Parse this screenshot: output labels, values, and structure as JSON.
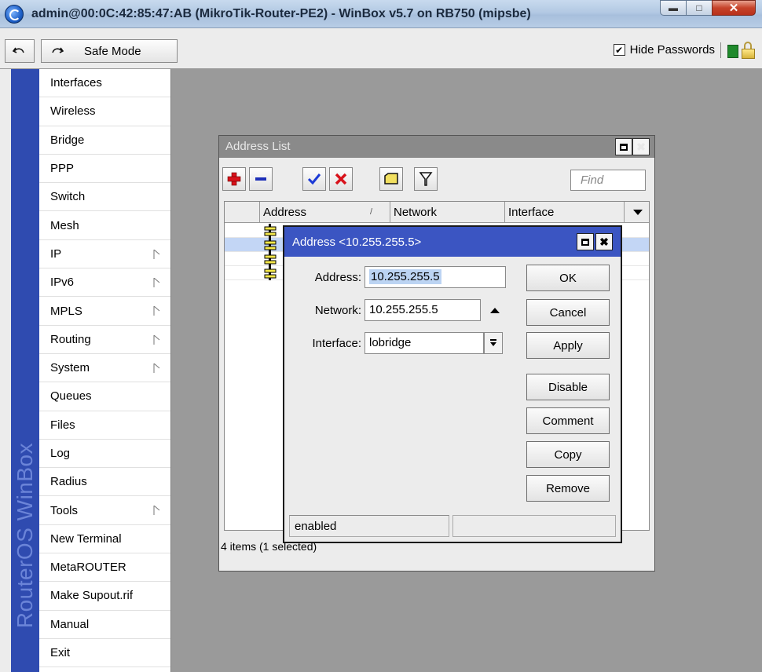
{
  "window": {
    "title": "admin@00:0C:42:85:47:AB (MikroTik-Router-PE2) - WinBox v5.7 on RB750 (mipsbe)"
  },
  "toolbar": {
    "undo_icon": "undo-icon",
    "redo_icon": "redo-icon",
    "safe_mode_label": "Safe Mode",
    "hide_passwords_label": "Hide Passwords",
    "hide_passwords_checked": true
  },
  "sidebar": {
    "brand": "RouterOS WinBox",
    "items": [
      {
        "label": "Interfaces",
        "submenu": false
      },
      {
        "label": "Wireless",
        "submenu": false
      },
      {
        "label": "Bridge",
        "submenu": false
      },
      {
        "label": "PPP",
        "submenu": false
      },
      {
        "label": "Switch",
        "submenu": false
      },
      {
        "label": "Mesh",
        "submenu": false
      },
      {
        "label": "IP",
        "submenu": true
      },
      {
        "label": "IPv6",
        "submenu": true
      },
      {
        "label": "MPLS",
        "submenu": true
      },
      {
        "label": "Routing",
        "submenu": true
      },
      {
        "label": "System",
        "submenu": true
      },
      {
        "label": "Queues",
        "submenu": false
      },
      {
        "label": "Files",
        "submenu": false
      },
      {
        "label": "Log",
        "submenu": false
      },
      {
        "label": "Radius",
        "submenu": false
      },
      {
        "label": "Tools",
        "submenu": true
      },
      {
        "label": "New Terminal",
        "submenu": false
      },
      {
        "label": "MetaROUTER",
        "submenu": false
      },
      {
        "label": "Make Supout.rif",
        "submenu": false
      },
      {
        "label": "Manual",
        "submenu": false
      },
      {
        "label": "Exit",
        "submenu": false
      }
    ]
  },
  "address_list": {
    "title": "Address List",
    "find_placeholder": "Find",
    "columns": [
      "Address",
      "Network",
      "Interface"
    ],
    "sort_indicator": "/",
    "rows": 4,
    "selected_row": 1,
    "status": "4 items (1 selected)"
  },
  "address_dialog": {
    "title": "Address <10.255.255.5>",
    "address_label": "Address:",
    "address_value": "10.255.255.5",
    "network_label": "Network:",
    "network_value": "10.255.255.5",
    "interface_label": "Interface:",
    "interface_value": "lobridge",
    "buttons": {
      "ok": "OK",
      "cancel": "Cancel",
      "apply": "Apply",
      "disable": "Disable",
      "comment": "Comment",
      "copy": "Copy",
      "remove": "Remove"
    },
    "status": "enabled"
  },
  "colors": {
    "dialog_title": "#3b55c2",
    "sidebar_brand": "#2f4bb0",
    "selected_row": "#c3d6f5"
  }
}
